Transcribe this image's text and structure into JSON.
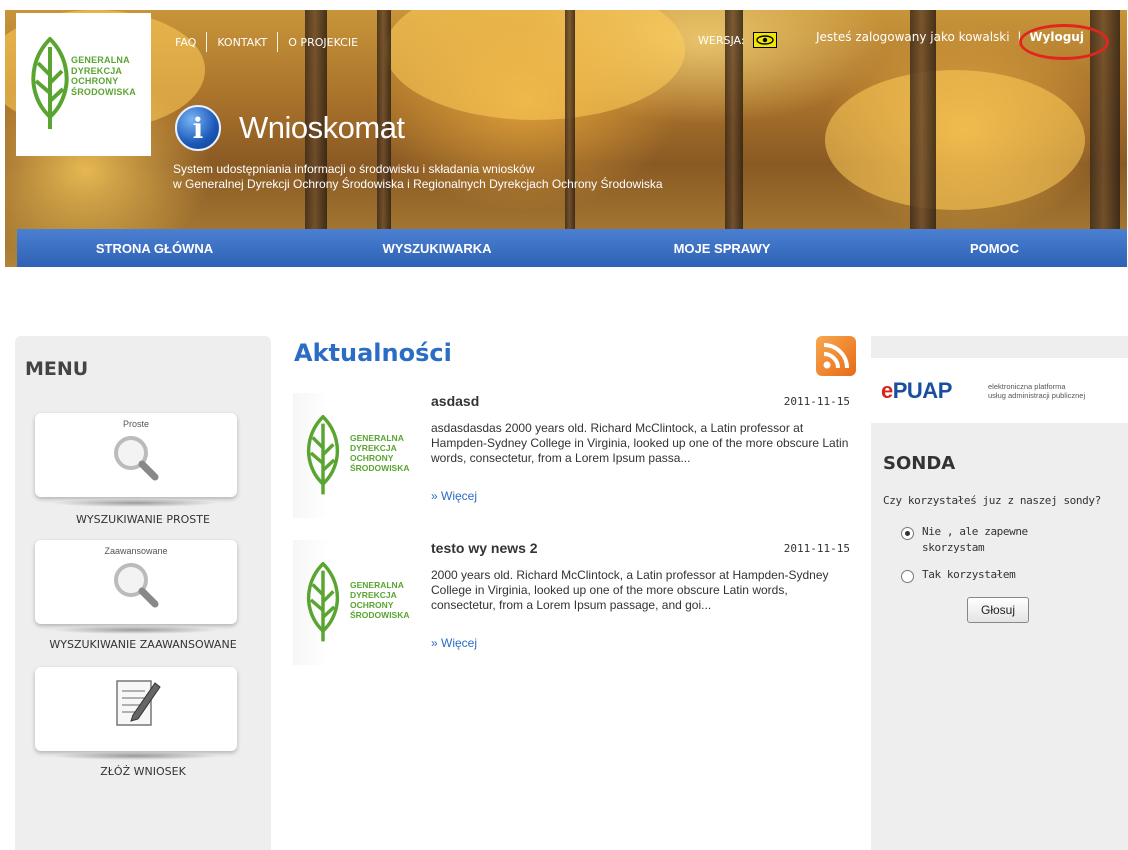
{
  "header": {
    "logo_lines": [
      "GENERALNA",
      "DYREKCJA",
      "OCHRONY",
      "ŚRODOWISKA"
    ],
    "links": [
      "FAQ",
      "KONTAKT",
      "O PROJEKCIE"
    ],
    "version_label": "WERSJA:",
    "logged_in_text": "Jesteś zalogowany jako kowalski",
    "separator": "|",
    "logout_label": "Wyloguj",
    "app_name": "Wnioskomat",
    "subtitle_line1": "System udostępniania informacji o środowisku i składania wniosków",
    "subtitle_line2": "w Generalnej Dyrekcji Ochrony Środowiska i Regionalnych Dyrekcjach Ochrony Środowiska"
  },
  "nav": [
    "STRONA GŁÓWNA",
    "WYSZUKIWARKA",
    "MOJE SPRAWY",
    "POMOC"
  ],
  "menu": {
    "title": "MENU",
    "tiles": [
      {
        "caption": "Proste",
        "label": "WYSZUKIWANIE PROSTE"
      },
      {
        "caption": "Zaawansowane",
        "label": "WYSZUKIWANIE ZAAWANSOWANE"
      },
      {
        "caption": "",
        "label": "ZŁÓŻ WNIOSEK"
      }
    ]
  },
  "news": {
    "title": "Aktualności",
    "items": [
      {
        "title": "asdasd",
        "date": "2011-11-15",
        "body": "asdasdasdas 2000 years old. Richard McClintock, a Latin professor at Hampden-Sydney College in Virginia, looked up one of the more obscure Latin words, consectetur, from a Lorem Ipsum passa...",
        "more": "» Więcej"
      },
      {
        "title": "testo wy news 2",
        "date": "2011-11-15",
        "body": " 2000 years old. Richard McClintock, a Latin professor at Hampden-Sydney College in Virginia, looked up one of the more obscure Latin words, consectetur, from a Lorem Ipsum passage, and goi...",
        "more": "» Więcej"
      }
    ]
  },
  "epuap": {
    "logo_e": "e",
    "logo_rest": "PUAP",
    "desc_line1": "elektroniczna platforma",
    "desc_line2": "usług administracji publicznej"
  },
  "poll": {
    "title": "SONDA",
    "question": "Czy korzystałeś juz z naszej sondy?",
    "option1_line1": "Nie , ale zapewne",
    "option1_line2": "skorzystam",
    "option2": "Tak korzystałem",
    "selected": 0,
    "vote_label": "Głosuj"
  },
  "colors": {
    "accent_blue": "#2b6cc4",
    "nav_blue": "#3a6fc4",
    "logo_green": "#5aa532",
    "logout_ring": "#e0261f"
  },
  "icons": [
    "info-icon",
    "eye-icon",
    "magnifier-icon",
    "document-pencil-icon",
    "rss-icon",
    "leaf-logo-icon"
  ]
}
